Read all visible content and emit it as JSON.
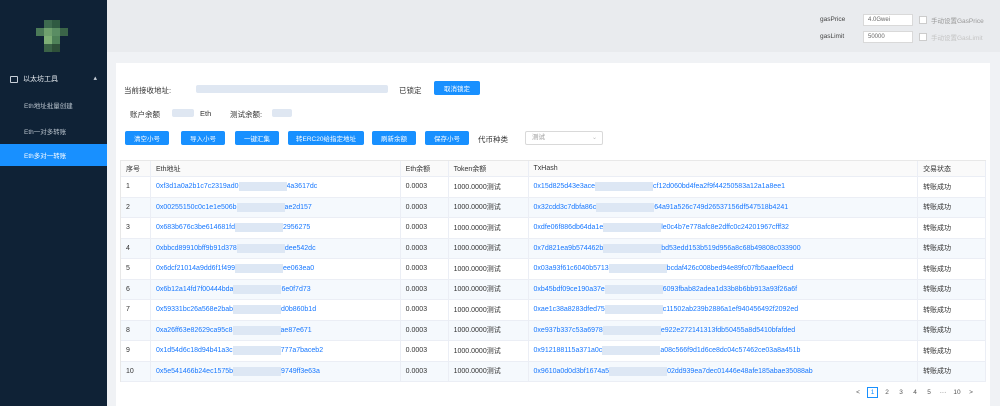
{
  "sidebar": {
    "group_label": "以太坊工具",
    "items": [
      {
        "label": "Eth地址批量创建"
      },
      {
        "label": "Eth一对多转账"
      },
      {
        "label": "Eth多对一转账"
      }
    ]
  },
  "gas": {
    "price_label": "gasPrice",
    "price_value": "4.0Gwei",
    "price_manual": "手动设置GasPrice",
    "limit_label": "gasLimit",
    "limit_value": "50000",
    "limit_manual": "手动设置GasLimit"
  },
  "panel": {
    "receive_label": "当前接收地址:",
    "locked_text": "已锁定",
    "unlock_button": "取消锁定",
    "balance_label": "账户余额",
    "balance_unit": "Eth",
    "test_balance_label": "测试余额:",
    "buttons": [
      "清空小号",
      "导入小号",
      "一键汇集",
      "转ERC20给指定地址",
      "刷新余额",
      "保存小号"
    ],
    "token_type_label": "代币种类",
    "token_select_value": "测试"
  },
  "table": {
    "headers": [
      "序号",
      "Eth地址",
      "Eth余额",
      "Token余额",
      "TxHash",
      "交易状态"
    ],
    "rows": [
      {
        "idx": "1",
        "addr_a": "0xf3d1a0a2b1c7c2319ad0",
        "addr_b": "4a3617dc",
        "eth": "0.0003",
        "token": "1000.0000测试",
        "hash_a": "0x15d825d43e3ace",
        "hash_b": "cf12d060bd4fea2f9f44250583a12a1a8ee1",
        "status": "转账成功"
      },
      {
        "idx": "2",
        "addr_a": "0x00255150c0c1e1e506b",
        "addr_b": "ae2d157",
        "eth": "0.0003",
        "token": "1000.0000测试",
        "hash_a": "0x32cdd3c7dbfa86c",
        "hash_b": "64a91a526c749d26537156df547518b4241",
        "status": "转账成功"
      },
      {
        "idx": "3",
        "addr_a": "0x683b676c3be614681fd",
        "addr_b": "2956275",
        "eth": "0.0003",
        "token": "1000.0000测试",
        "hash_a": "0xdfe06f886db64da1e",
        "hash_b": "le0c4b7e778afc8e2dffc0c24201967cfff32",
        "status": "转账成功"
      },
      {
        "idx": "4",
        "addr_a": "0xbbcd89910bff9b91d378",
        "addr_b": "dee542dc",
        "eth": "0.0003",
        "token": "1000.0000测试",
        "hash_a": "0x7d821ea9b574462b",
        "hash_b": "bd53edd153b519d956a8c68b49808c033900",
        "status": "转账成功"
      },
      {
        "idx": "5",
        "addr_a": "0x6dcf21014a9dd6f1f499",
        "addr_b": "ee063ea0",
        "eth": "0.0003",
        "token": "1000.0000测试",
        "hash_a": "0x03a93f61c6040b5713",
        "hash_b": "bcdaf426c008bed94e89fc07fb5aaef0ecd",
        "status": "转账成功"
      },
      {
        "idx": "6",
        "addr_a": "0x6b12a14fd7f00444bda",
        "addr_b": "6e0f7d73",
        "eth": "0.0003",
        "token": "1000.0000测试",
        "hash_a": "0xb45bdf09ce190a37e",
        "hash_b": "6093fbab82adea1d33b8b6bb913a93f26a6f",
        "status": "转账成功"
      },
      {
        "idx": "7",
        "addr_a": "0x59331bc26a568e2bab",
        "addr_b": "d0b860b1d",
        "eth": "0.0003",
        "token": "1000.0000测试",
        "hash_a": "0xae1c38a8283dfed75",
        "hash_b": "c11502ab239b2886a1ef940456492f2092ed",
        "status": "转账成功"
      },
      {
        "idx": "8",
        "addr_a": "0xa26ff63e82629ca95c8",
        "addr_b": "ae87e671",
        "eth": "0.0003",
        "token": "1000.0000测试",
        "hash_a": "0xe937b337c53a6978",
        "hash_b": "e922e272141313fdb50455a8d5410bfafded",
        "status": "转账成功"
      },
      {
        "idx": "9",
        "addr_a": "0x1d54d6c18d94b41a3c",
        "addr_b": "777a7baceb2",
        "eth": "0.0003",
        "token": "1000.0000测试",
        "hash_a": "0x912188115a371a0c",
        "hash_b": "a08c566f9d1d6ce8dc04c57462ce03a8a451b",
        "status": "转账成功"
      },
      {
        "idx": "10",
        "addr_a": "0x5e541466b24ec1575b",
        "addr_b": "9749ff3e63a",
        "eth": "0.0003",
        "token": "1000.0000测试",
        "hash_a": "0x9610a0d0d3bf1674a5",
        "hash_b": "02dd939ea7dec01446e48afe185abae35088ab",
        "status": "转账成功"
      }
    ]
  },
  "pager": {
    "prev": "<",
    "pages": [
      "1",
      "2",
      "3",
      "4",
      "5"
    ],
    "ellipsis": "···",
    "last": "10",
    "next": ">",
    "current": "1"
  },
  "colors": {
    "sidebar_bg": "#0f2236",
    "accent": "#1890ff",
    "link": "#1677ff"
  }
}
